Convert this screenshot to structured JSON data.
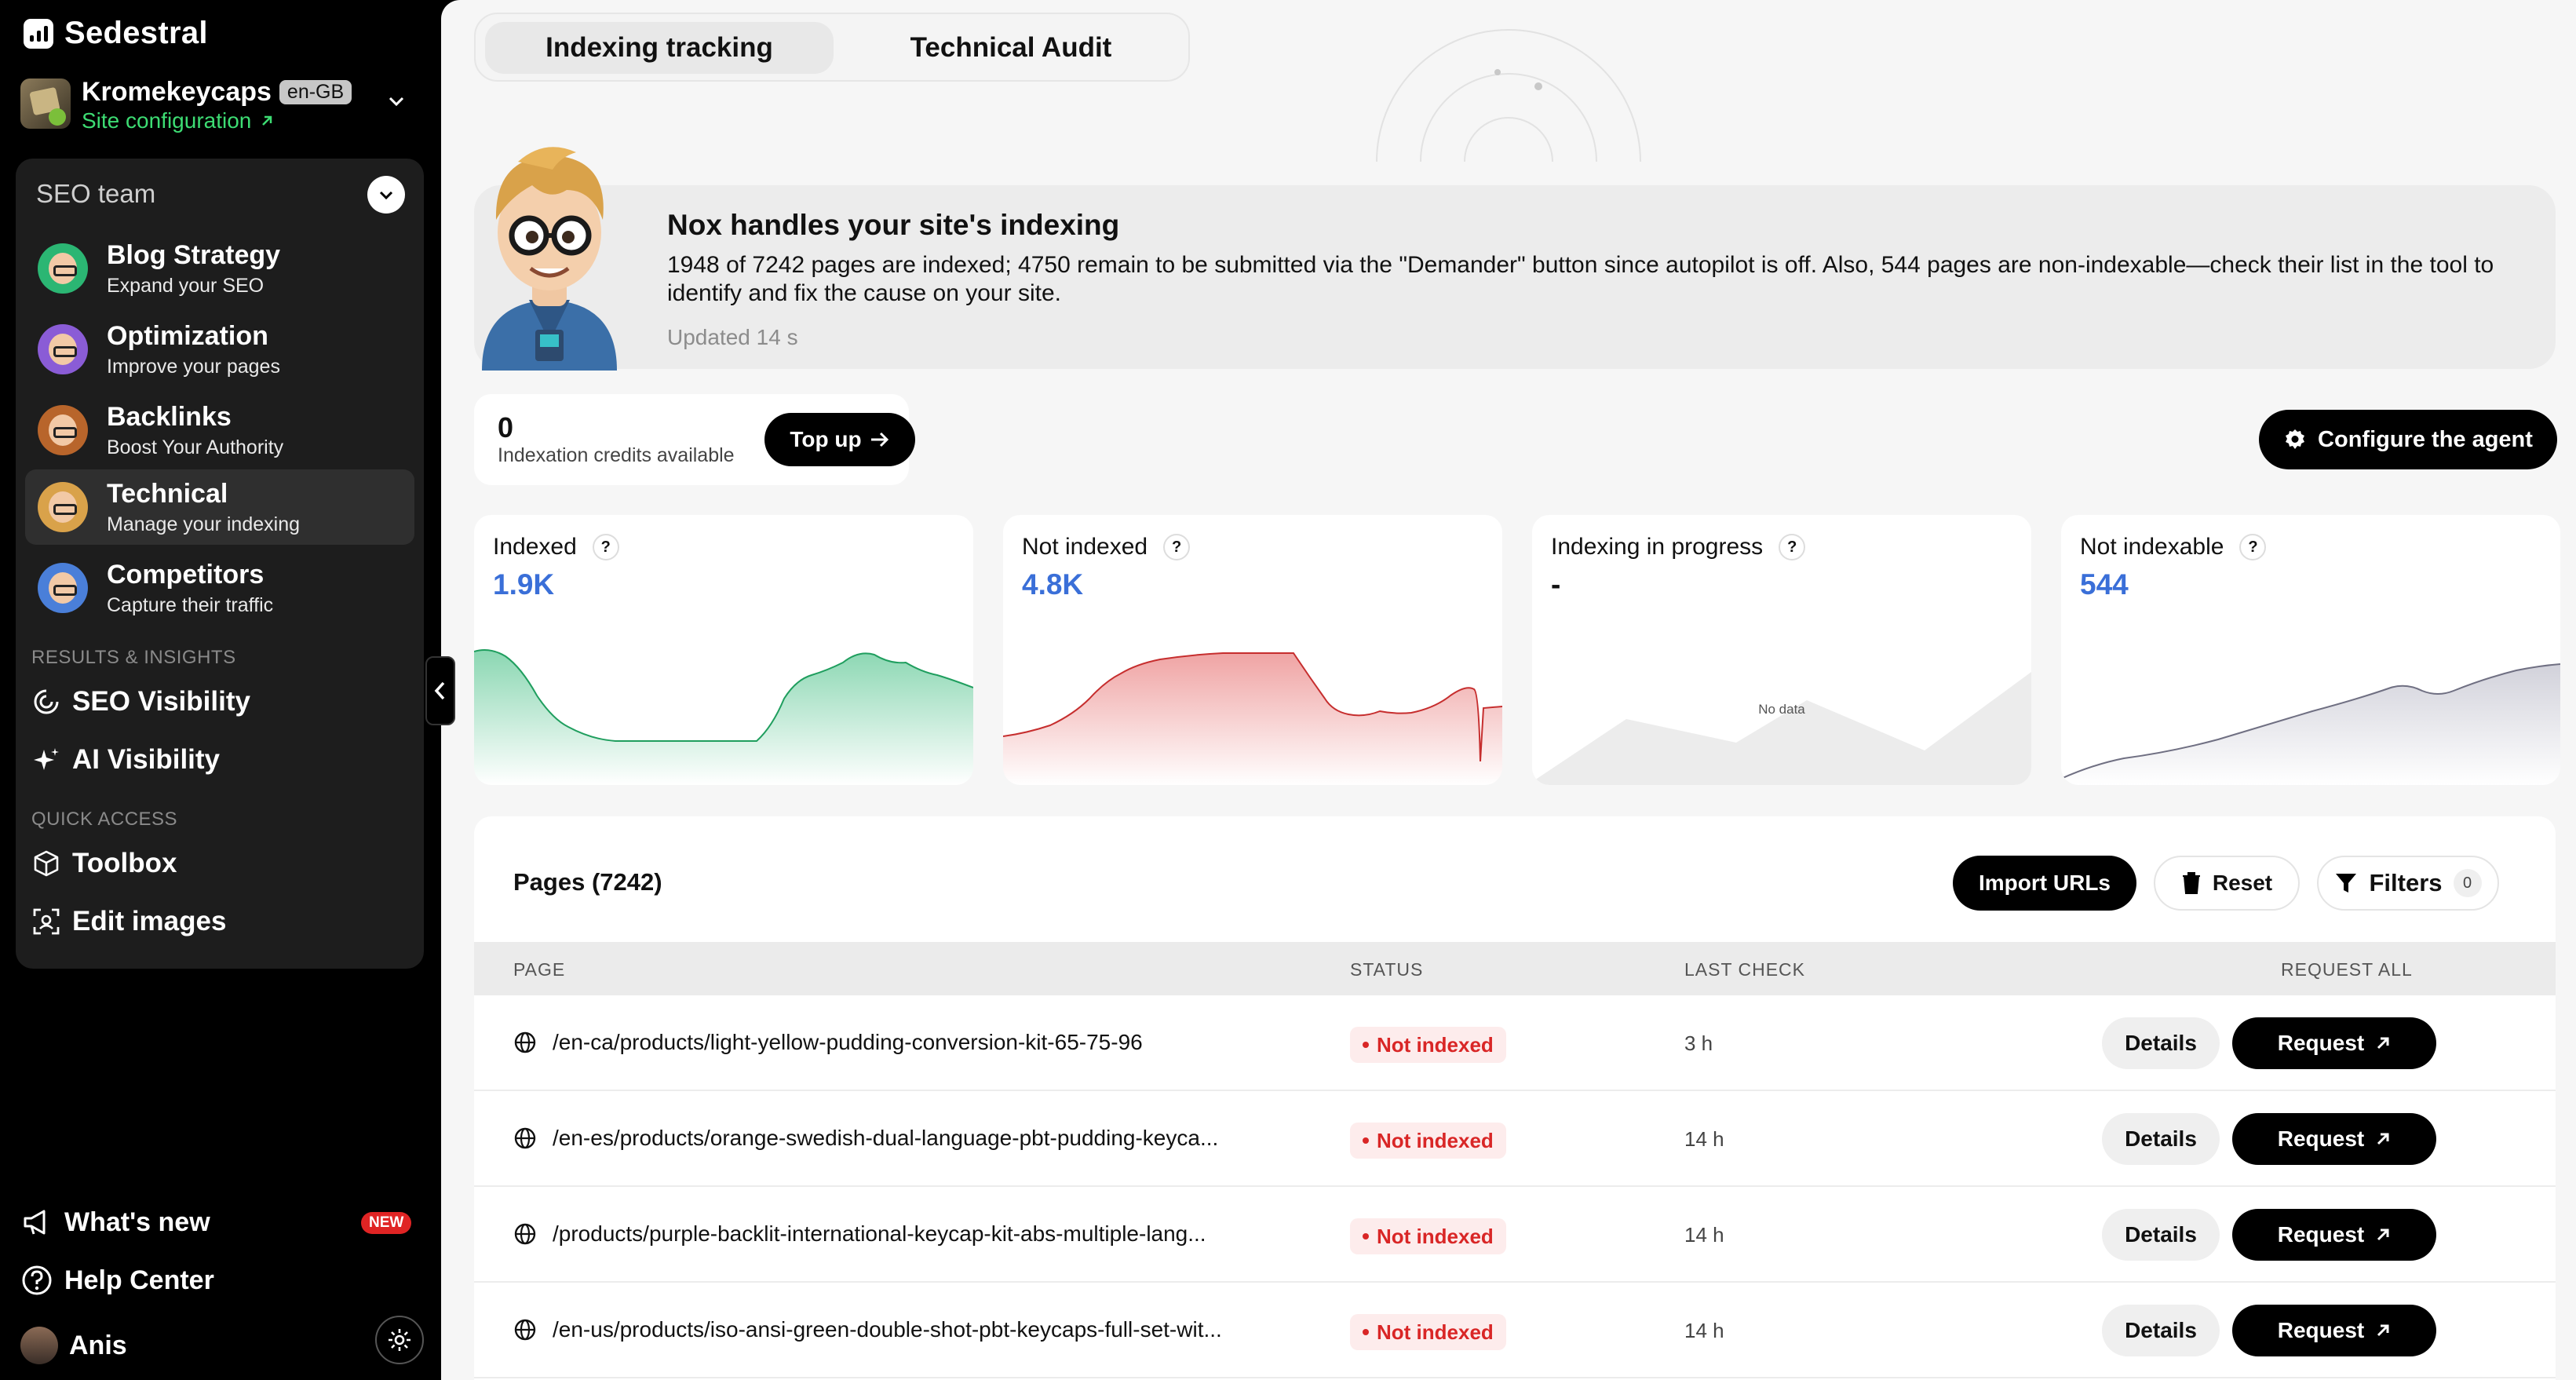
{
  "brand": {
    "name": "Sedestral"
  },
  "site": {
    "name": "Kromekeycaps",
    "lang": "en-GB",
    "config_label": "Site configuration"
  },
  "team": {
    "title": "SEO team",
    "agents": [
      {
        "title": "Blog Strategy",
        "subtitle": "Expand your SEO",
        "avatar_color": "#2bb673"
      },
      {
        "title": "Optimization",
        "subtitle": "Improve your pages",
        "avatar_color": "#8a5cd6"
      },
      {
        "title": "Backlinks",
        "subtitle": "Boost Your Authority",
        "avatar_color": "#b8652b"
      },
      {
        "title": "Technical",
        "subtitle": "Manage your indexing",
        "avatar_color": "#d9a24a"
      },
      {
        "title": "Competitors",
        "subtitle": "Capture their traffic",
        "avatar_color": "#4a7fd9"
      }
    ]
  },
  "results": {
    "label": "RESULTS & INSIGHTS",
    "items": [
      {
        "label": "SEO Visibility",
        "icon": "visibility-icon"
      },
      {
        "label": "AI Visibility",
        "icon": "sparkle-icon"
      }
    ]
  },
  "quick_access": {
    "label": "QUICK ACCESS",
    "items": [
      {
        "label": "Toolbox",
        "icon": "box-icon"
      },
      {
        "label": "Edit images",
        "icon": "image-edit-icon"
      }
    ]
  },
  "footer": {
    "whats_new": "What's new",
    "new_badge": "NEW",
    "help": "Help Center",
    "user": "Anis"
  },
  "tabs": {
    "active": "Indexing tracking",
    "other": "Technical Audit"
  },
  "hero": {
    "title": "Nox handles your site's indexing",
    "text": "1948 of 7242 pages are indexed; 4750 remain to be submitted via the \"Demander\" button since autopilot is off. Also, 544 pages are non-indexable—check their list in the tool to identify and fix the cause on your site.",
    "updated": "Updated 14 s"
  },
  "credits": {
    "count": "0",
    "label": "Indexation credits available",
    "topup": "Top up"
  },
  "configure_agent": "Configure the agent",
  "cards": [
    {
      "title": "Indexed",
      "value": "1.9K",
      "color": "#2bb673"
    },
    {
      "title": "Not indexed",
      "value": "4.8K",
      "color": "#e04848"
    },
    {
      "title": "Indexing in progress",
      "value": "-",
      "no_data": "No data"
    },
    {
      "title": "Not indexable",
      "value": "544",
      "color": "#8a8a9a"
    }
  ],
  "pages": {
    "title": "Pages (7242)",
    "import": "Import URLs",
    "reset": "Reset",
    "filters": "Filters",
    "filter_count": "0",
    "columns": {
      "page": "PAGE",
      "status": "STATUS",
      "last_check": "LAST CHECK",
      "request_all": "REQUEST ALL"
    },
    "rows": [
      {
        "url": "/en-ca/products/light-yellow-pudding-conversion-kit-65-75-96",
        "status": "Not indexed",
        "last_check": "3 h"
      },
      {
        "url": "/en-es/products/orange-swedish-dual-language-pbt-pudding-keyca...",
        "status": "Not indexed",
        "last_check": "14 h"
      },
      {
        "url": "/products/purple-backlit-international-keycap-kit-abs-multiple-lang...",
        "status": "Not indexed",
        "last_check": "14 h"
      },
      {
        "url": "/en-us/products/iso-ansi-green-double-shot-pbt-keycaps-full-set-wit...",
        "status": "Not indexed",
        "last_check": "14 h"
      }
    ],
    "details_label": "Details",
    "request_label": "Request"
  }
}
